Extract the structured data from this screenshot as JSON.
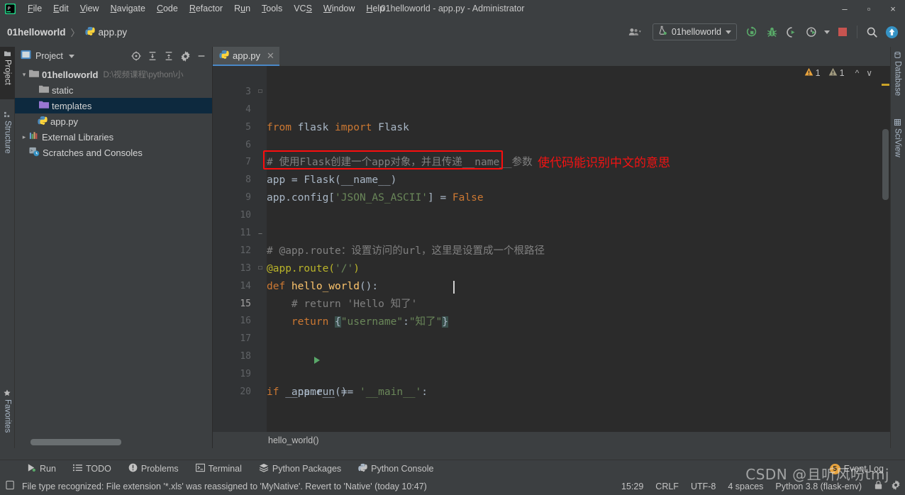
{
  "window": {
    "title": "01helloworld - app.py - Administrator",
    "logo_icon": "pycharm-logo-icon",
    "minimize_label": "–",
    "maximize_label": "▫",
    "close_label": "×"
  },
  "menubar": {
    "items": [
      {
        "label": "File",
        "mnemonic": "F"
      },
      {
        "label": "Edit",
        "mnemonic": "E"
      },
      {
        "label": "View",
        "mnemonic": "V"
      },
      {
        "label": "Navigate",
        "mnemonic": "N"
      },
      {
        "label": "Code",
        "mnemonic": "C"
      },
      {
        "label": "Refactor",
        "mnemonic": "R"
      },
      {
        "label": "Run",
        "mnemonic": "u"
      },
      {
        "label": "Tools",
        "mnemonic": "T"
      },
      {
        "label": "VCS",
        "mnemonic": "S"
      },
      {
        "label": "Window",
        "mnemonic": "W"
      },
      {
        "label": "Help",
        "mnemonic": "H"
      }
    ]
  },
  "navbar": {
    "breadcrumb": {
      "project": "01helloworld",
      "separator": "〉",
      "file": "app.py",
      "file_icon": "python-file-icon"
    },
    "toolbar": {
      "user_icon": "user-accounts-icon",
      "run_config_name": "01helloworld",
      "run_config_icon": "flask-run-config-icon",
      "run_icon": "run-icon",
      "debug_icon": "debug-bug-icon",
      "run_with_coverage_icon": "run-coverage-icon",
      "profile_icon": "profile-clock-icon",
      "stop_icon": "stop-icon",
      "search_icon": "search-everywhere-icon",
      "update_icon": "update-project-icon"
    }
  },
  "left_rail": {
    "tabs": [
      {
        "label": "Project",
        "icon": "project-folder-icon",
        "active": true
      },
      {
        "label": "Structure",
        "icon": "structure-icon",
        "active": false
      },
      {
        "label": "Favorites",
        "icon": "star-icon",
        "active": false
      }
    ]
  },
  "right_rail": {
    "tabs": [
      {
        "label": "Database",
        "icon": "database-icon"
      },
      {
        "label": "SciView",
        "icon": "sciview-grid-icon"
      }
    ]
  },
  "project_panel": {
    "title": "Project",
    "title_icon": "project-window-icon",
    "dropdown_icon": "chevron-down-icon",
    "tools": [
      {
        "name": "select-opened-file-icon",
        "glyph": "⊕"
      },
      {
        "name": "expand-all-icon",
        "glyph": "⤓"
      },
      {
        "name": "collapse-all-icon",
        "glyph": "⤒"
      },
      {
        "name": "settings-gear-icon",
        "glyph": "⚙"
      },
      {
        "name": "hide-panel-icon",
        "glyph": "–"
      }
    ],
    "tree": [
      {
        "label": "01helloworld",
        "path": "D:\\视频课程\\python\\小",
        "icon": "folder-icon",
        "indent": 0,
        "arrow": "expanded",
        "bold": true,
        "selected": false
      },
      {
        "label": "static",
        "icon": "folder-icon",
        "indent": 1,
        "arrow": "none",
        "bold": false,
        "selected": false
      },
      {
        "label": "templates",
        "icon": "folder-templates-icon",
        "indent": 1,
        "arrow": "none",
        "bold": false,
        "selected": true
      },
      {
        "label": "app.py",
        "icon": "python-file-icon",
        "indent": 1,
        "arrow": "none",
        "bold": false,
        "selected": false
      },
      {
        "label": "External Libraries",
        "icon": "libraries-icon",
        "indent": 0,
        "arrow": "collapsed",
        "bold": false,
        "selected": false
      },
      {
        "label": "Scratches and Consoles",
        "icon": "scratches-icon",
        "indent": 0,
        "arrow": "none",
        "bold": false,
        "selected": false
      }
    ]
  },
  "editor": {
    "tab": {
      "label": "app.py",
      "icon": "python-file-icon",
      "close_icon": "close-icon"
    },
    "inspections": {
      "warning_count": "1",
      "weak_warning_count": "1",
      "warning_icon": "warning-triangle-icon",
      "weak_warning_icon": "weak-warning-triangle-icon",
      "prev_icon": "chevron-up-icon",
      "next_icon": "chevron-down-icon"
    },
    "first_line_number": 3,
    "lines": [
      {
        "num": 3,
        "text": ""
      },
      {
        "num": 4,
        "text": "from flask import Flask"
      },
      {
        "num": 5,
        "text": ""
      },
      {
        "num": 6,
        "text": "# 使用Flask创建一个app对象，并且传递__name__参数"
      },
      {
        "num": 7,
        "text": "app = Flask(__name__)"
      },
      {
        "num": 8,
        "text": "app.config['JSON_AS_ASCII'] = False"
      },
      {
        "num": 9,
        "text": ""
      },
      {
        "num": 10,
        "text": ""
      },
      {
        "num": 11,
        "text": "# @app.route：设置访问的url，这里是设置成一个根路径"
      },
      {
        "num": 12,
        "text": "@app.route('/')"
      },
      {
        "num": 13,
        "text": "def hello_world():"
      },
      {
        "num": 14,
        "text": "    # return 'Hello 知了'"
      },
      {
        "num": 15,
        "text": "    return {\"username\":\"知了\"}"
      },
      {
        "num": 16,
        "text": ""
      },
      {
        "num": 17,
        "text": ""
      },
      {
        "num": 18,
        "text": "if __name__ == '__main__':"
      },
      {
        "num": 19,
        "text": "    app.run()"
      },
      {
        "num": 20,
        "text": ""
      }
    ],
    "tokens": {
      "l4": [
        {
          "t": "from ",
          "c": "kw"
        },
        {
          "t": "flask ",
          "c": ""
        },
        {
          "t": "import ",
          "c": "kw"
        },
        {
          "t": "Flask",
          "c": ""
        }
      ],
      "l6": [
        {
          "t": "# 使用Flask创建一个app对象，并且传递__name__参数",
          "c": "cmt"
        }
      ],
      "l7": [
        {
          "t": "app = Flask(__name__)",
          "c": ""
        }
      ],
      "l8": [
        {
          "t": "app.config[",
          "c": ""
        },
        {
          "t": "'JSON_AS_ASCII'",
          "c": "str"
        },
        {
          "t": "] = ",
          "c": ""
        },
        {
          "t": "False",
          "c": "kw"
        }
      ],
      "l11": [
        {
          "t": "# @app.route：设置访问的url，这里是设置成一个根路径",
          "c": "cmt"
        }
      ],
      "l12": [
        {
          "t": "@app.route(",
          "c": "dec"
        },
        {
          "t": "'/'",
          "c": "str"
        },
        {
          "t": ")",
          "c": "dec"
        }
      ],
      "l13": [
        {
          "t": "def ",
          "c": "kw"
        },
        {
          "t": "hello_world",
          "c": "fn"
        },
        {
          "t": "():",
          "c": ""
        }
      ],
      "l14": [
        {
          "t": "    # return 'Hello 知了'",
          "c": "cmt"
        }
      ],
      "l15": [
        {
          "t": "    ",
          "c": ""
        },
        {
          "t": "return ",
          "c": "kw"
        },
        {
          "t": "{",
          "c": "brace"
        },
        {
          "t": "\"username\"",
          "c": "str"
        },
        {
          "t": ":",
          "c": ""
        },
        {
          "t": "\"知了\"",
          "c": "str"
        },
        {
          "t": "}",
          "c": "brace"
        }
      ],
      "l18": [
        {
          "t": "if ",
          "c": "kw"
        },
        {
          "t": "__name__ == ",
          "c": ""
        },
        {
          "t": "'__main__'",
          "c": "str"
        },
        {
          "t": ":",
          "c": ""
        }
      ],
      "l19": [
        {
          "t": "    app.run()",
          "c": ""
        }
      ]
    },
    "annotation": {
      "text": "使代码能识别中文的意思",
      "color": "#f41212",
      "highlight_box_color": "#fd0d0d",
      "highlighted_line": 8
    },
    "breadcrumb": "hello_world()",
    "run_line_marker": {
      "line": 18,
      "icon": "run-arrow-icon"
    }
  },
  "bottom_tool_window": {
    "items": [
      {
        "label": "Run",
        "icon": "run-arrow-icon"
      },
      {
        "label": "TODO",
        "icon": "todo-list-icon"
      },
      {
        "label": "Problems",
        "icon": "problems-icon"
      },
      {
        "label": "Terminal",
        "icon": "terminal-icon"
      },
      {
        "label": "Python Packages",
        "icon": "packages-icon"
      },
      {
        "label": "Python Console",
        "icon": "python-console-icon"
      }
    ],
    "event_log": {
      "label": "Event Log",
      "badge": "5"
    }
  },
  "status_bar": {
    "message_icon": "notification-icon",
    "message": "File type recognized: File extension '*.xls' was reassigned to 'MyNative'. Revert to 'Native' (today 10:47)",
    "caret_position": "15:29",
    "line_separator": "CRLF",
    "encoding": "UTF-8",
    "indent": "4 spaces",
    "interpreter": "Python 3.8 (flask-env)",
    "lock_icon": "read-only-lock-icon",
    "settings_icon": "settings-gear-icon"
  },
  "watermark": {
    "text": "CSDN @且听风吩tmj"
  },
  "colors": {
    "accent_blue": "#4a88c7",
    "selection_blue": "#0d293e",
    "editor_bg": "#2b2b2b",
    "chrome_bg": "#3c3f41",
    "keyword_orange": "#cc7832",
    "string_green": "#6a8759",
    "comment_gray": "#808080",
    "function_yellow": "#ffc66d",
    "decorator_olive": "#bbb529",
    "annotation_red": "#f41212",
    "warning_amber": "#e8a33d",
    "run_green": "#59a869"
  }
}
